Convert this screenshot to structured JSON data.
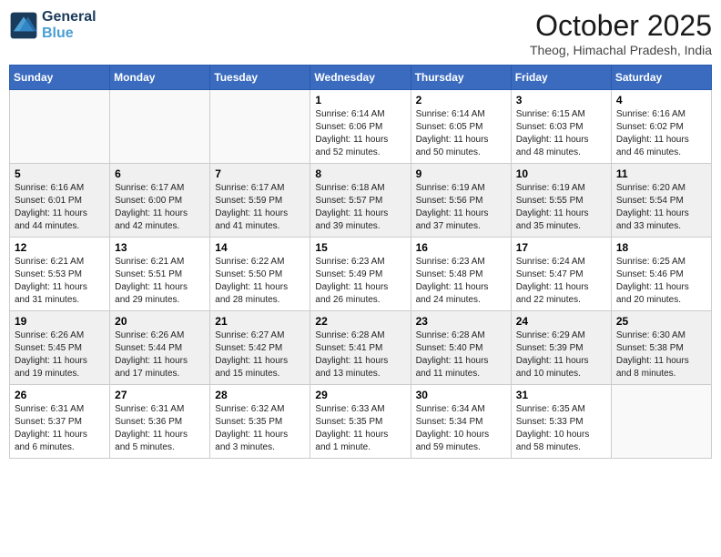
{
  "logo": {
    "line1": "General",
    "line2": "Blue"
  },
  "title": "October 2025",
  "location": "Theog, Himachal Pradesh, India",
  "weekdays": [
    "Sunday",
    "Monday",
    "Tuesday",
    "Wednesday",
    "Thursday",
    "Friday",
    "Saturday"
  ],
  "weeks": [
    [
      {
        "day": "",
        "info": ""
      },
      {
        "day": "",
        "info": ""
      },
      {
        "day": "",
        "info": ""
      },
      {
        "day": "1",
        "info": "Sunrise: 6:14 AM\nSunset: 6:06 PM\nDaylight: 11 hours\nand 52 minutes."
      },
      {
        "day": "2",
        "info": "Sunrise: 6:14 AM\nSunset: 6:05 PM\nDaylight: 11 hours\nand 50 minutes."
      },
      {
        "day": "3",
        "info": "Sunrise: 6:15 AM\nSunset: 6:03 PM\nDaylight: 11 hours\nand 48 minutes."
      },
      {
        "day": "4",
        "info": "Sunrise: 6:16 AM\nSunset: 6:02 PM\nDaylight: 11 hours\nand 46 minutes."
      }
    ],
    [
      {
        "day": "5",
        "info": "Sunrise: 6:16 AM\nSunset: 6:01 PM\nDaylight: 11 hours\nand 44 minutes."
      },
      {
        "day": "6",
        "info": "Sunrise: 6:17 AM\nSunset: 6:00 PM\nDaylight: 11 hours\nand 42 minutes."
      },
      {
        "day": "7",
        "info": "Sunrise: 6:17 AM\nSunset: 5:59 PM\nDaylight: 11 hours\nand 41 minutes."
      },
      {
        "day": "8",
        "info": "Sunrise: 6:18 AM\nSunset: 5:57 PM\nDaylight: 11 hours\nand 39 minutes."
      },
      {
        "day": "9",
        "info": "Sunrise: 6:19 AM\nSunset: 5:56 PM\nDaylight: 11 hours\nand 37 minutes."
      },
      {
        "day": "10",
        "info": "Sunrise: 6:19 AM\nSunset: 5:55 PM\nDaylight: 11 hours\nand 35 minutes."
      },
      {
        "day": "11",
        "info": "Sunrise: 6:20 AM\nSunset: 5:54 PM\nDaylight: 11 hours\nand 33 minutes."
      }
    ],
    [
      {
        "day": "12",
        "info": "Sunrise: 6:21 AM\nSunset: 5:53 PM\nDaylight: 11 hours\nand 31 minutes."
      },
      {
        "day": "13",
        "info": "Sunrise: 6:21 AM\nSunset: 5:51 PM\nDaylight: 11 hours\nand 29 minutes."
      },
      {
        "day": "14",
        "info": "Sunrise: 6:22 AM\nSunset: 5:50 PM\nDaylight: 11 hours\nand 28 minutes."
      },
      {
        "day": "15",
        "info": "Sunrise: 6:23 AM\nSunset: 5:49 PM\nDaylight: 11 hours\nand 26 minutes."
      },
      {
        "day": "16",
        "info": "Sunrise: 6:23 AM\nSunset: 5:48 PM\nDaylight: 11 hours\nand 24 minutes."
      },
      {
        "day": "17",
        "info": "Sunrise: 6:24 AM\nSunset: 5:47 PM\nDaylight: 11 hours\nand 22 minutes."
      },
      {
        "day": "18",
        "info": "Sunrise: 6:25 AM\nSunset: 5:46 PM\nDaylight: 11 hours\nand 20 minutes."
      }
    ],
    [
      {
        "day": "19",
        "info": "Sunrise: 6:26 AM\nSunset: 5:45 PM\nDaylight: 11 hours\nand 19 minutes."
      },
      {
        "day": "20",
        "info": "Sunrise: 6:26 AM\nSunset: 5:44 PM\nDaylight: 11 hours\nand 17 minutes."
      },
      {
        "day": "21",
        "info": "Sunrise: 6:27 AM\nSunset: 5:42 PM\nDaylight: 11 hours\nand 15 minutes."
      },
      {
        "day": "22",
        "info": "Sunrise: 6:28 AM\nSunset: 5:41 PM\nDaylight: 11 hours\nand 13 minutes."
      },
      {
        "day": "23",
        "info": "Sunrise: 6:28 AM\nSunset: 5:40 PM\nDaylight: 11 hours\nand 11 minutes."
      },
      {
        "day": "24",
        "info": "Sunrise: 6:29 AM\nSunset: 5:39 PM\nDaylight: 11 hours\nand 10 minutes."
      },
      {
        "day": "25",
        "info": "Sunrise: 6:30 AM\nSunset: 5:38 PM\nDaylight: 11 hours\nand 8 minutes."
      }
    ],
    [
      {
        "day": "26",
        "info": "Sunrise: 6:31 AM\nSunset: 5:37 PM\nDaylight: 11 hours\nand 6 minutes."
      },
      {
        "day": "27",
        "info": "Sunrise: 6:31 AM\nSunset: 5:36 PM\nDaylight: 11 hours\nand 5 minutes."
      },
      {
        "day": "28",
        "info": "Sunrise: 6:32 AM\nSunset: 5:35 PM\nDaylight: 11 hours\nand 3 minutes."
      },
      {
        "day": "29",
        "info": "Sunrise: 6:33 AM\nSunset: 5:35 PM\nDaylight: 11 hours\nand 1 minute."
      },
      {
        "day": "30",
        "info": "Sunrise: 6:34 AM\nSunset: 5:34 PM\nDaylight: 10 hours\nand 59 minutes."
      },
      {
        "day": "31",
        "info": "Sunrise: 6:35 AM\nSunset: 5:33 PM\nDaylight: 10 hours\nand 58 minutes."
      },
      {
        "day": "",
        "info": ""
      }
    ]
  ]
}
